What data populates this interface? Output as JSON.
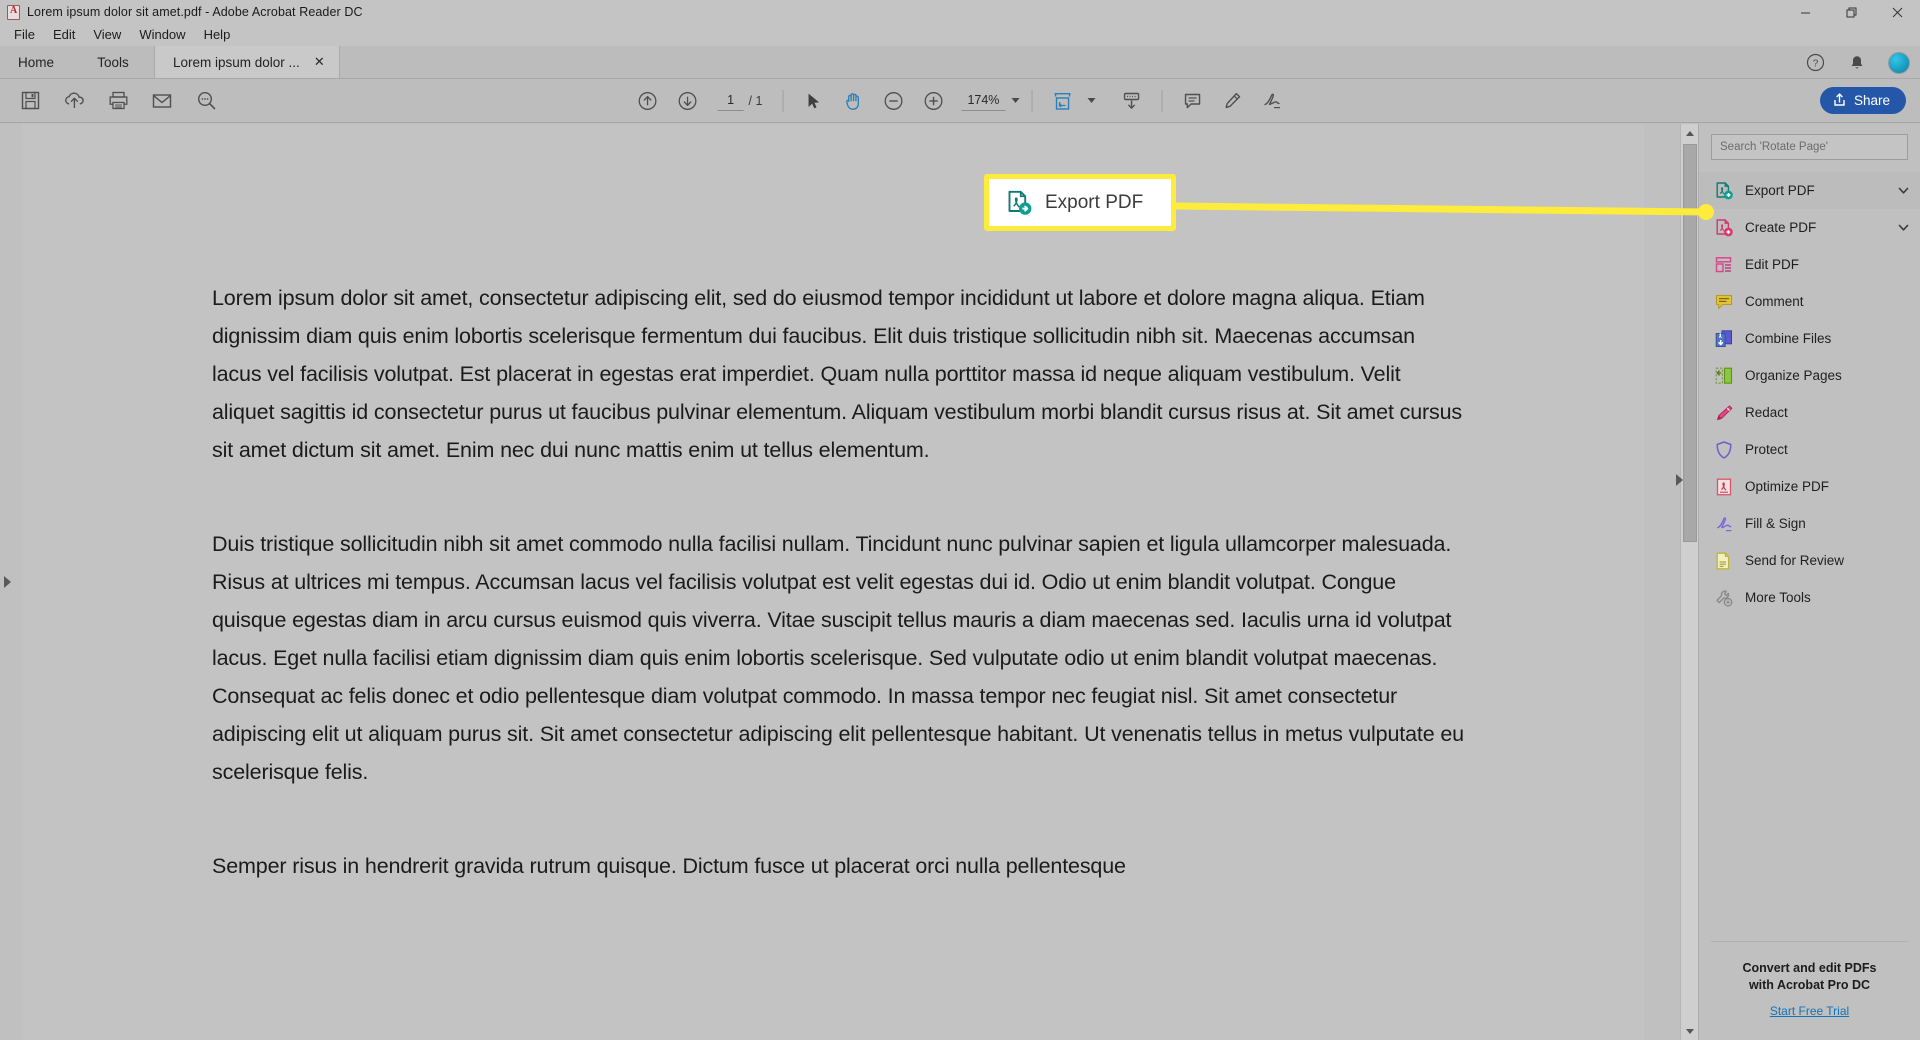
{
  "window": {
    "title": "Lorem ipsum dolor sit amet.pdf - Adobe Acrobat Reader DC",
    "app_icon": "acrobat-icon",
    "controls": {
      "minimize": "minimize",
      "restore": "restore",
      "close": "close"
    }
  },
  "menubar": {
    "items": [
      "File",
      "Edit",
      "View",
      "Window",
      "Help"
    ]
  },
  "tabs": {
    "home": "Home",
    "tools": "Tools",
    "document": "Lorem ipsum dolor ...",
    "close_label": "✕"
  },
  "tabbar_right": {
    "help_icon": "help-circle-icon",
    "bell_icon": "notification-bell-icon",
    "avatar": "user-avatar"
  },
  "toolbar": {
    "left_icons": [
      "save-icon",
      "upload-cloud-icon",
      "print-icon",
      "email-icon",
      "search-icon"
    ],
    "page_current": "1",
    "page_separator": "/ 1",
    "page_total": "1",
    "select_tool": "select-cursor-icon",
    "hand_tool": "hand-tool-icon",
    "zoom_out": "zoom-out-icon",
    "zoom_in": "zoom-in-icon",
    "zoom_value": "174%",
    "fit_page": "fit-page-icon",
    "scroll_mode": "page-scroll-icon",
    "comment_icon": "comment-icon",
    "highlight_icon": "highlighter-icon",
    "sign_icon": "sign-icon",
    "share_label": "Share",
    "share_icon": "share-upload-icon",
    "share_color": "#2557a8"
  },
  "document": {
    "paragraphs": [
      "Lorem ipsum dolor sit amet, consectetur adipiscing elit, sed do eiusmod tempor incididunt ut labore et dolore magna aliqua. Etiam dignissim diam quis enim lobortis scelerisque fermentum dui faucibus. Elit duis tristique sollicitudin nibh sit. Maecenas accumsan lacus vel facilisis volutpat. Est placerat in egestas erat imperdiet. Quam nulla porttitor massa id neque aliquam vestibulum. Velit aliquet sagittis id consectetur purus ut faucibus pulvinar elementum. Aliquam vestibulum morbi blandit cursus risus at. Sit amet cursus sit amet dictum sit amet. Enim nec dui nunc mattis enim ut tellus elementum.",
      "Duis tristique sollicitudin nibh sit amet commodo nulla facilisi nullam. Tincidunt nunc pulvinar sapien et ligula ullamcorper malesuada. Risus at ultrices mi tempus. Accumsan lacus vel facilisis volutpat est velit egestas dui id. Odio ut enim blandit volutpat. Congue quisque egestas diam in arcu cursus euismod quis viverra. Vitae suscipit tellus mauris a diam maecenas sed. Iaculis urna id volutpat lacus. Eget nulla facilisi etiam dignissim diam quis enim lobortis scelerisque. Sed vulputate odio ut enim blandit volutpat maecenas. Consequat ac felis donec et odio pellentesque diam volutpat commodo. In massa tempor nec feugiat nisl. Sit amet consectetur adipiscing elit ut aliquam purus sit. Sit amet consectetur adipiscing elit pellentesque habitant. Ut venenatis tellus in metus vulputate eu scelerisque felis.",
      "Semper risus in hendrerit gravida rutrum quisque. Dictum fusce ut placerat orci nulla pellentesque"
    ]
  },
  "sidebar": {
    "search_placeholder": "Search 'Rotate Page'",
    "items": [
      {
        "label": "Export PDF",
        "icon": "export-pdf-icon",
        "chevron": true
      },
      {
        "label": "Create PDF",
        "icon": "create-pdf-icon",
        "chevron": true
      },
      {
        "label": "Edit PDF",
        "icon": "edit-pdf-icon",
        "chevron": false
      },
      {
        "label": "Comment",
        "icon": "comment-icon",
        "chevron": false
      },
      {
        "label": "Combine Files",
        "icon": "combine-files-icon",
        "chevron": false
      },
      {
        "label": "Organize Pages",
        "icon": "organize-pages-icon",
        "chevron": false
      },
      {
        "label": "Redact",
        "icon": "redact-icon",
        "chevron": false
      },
      {
        "label": "Protect",
        "icon": "protect-shield-icon",
        "chevron": false
      },
      {
        "label": "Optimize PDF",
        "icon": "optimize-pdf-icon",
        "chevron": false
      },
      {
        "label": "Fill & Sign",
        "icon": "fill-sign-icon",
        "chevron": false
      },
      {
        "label": "Send for Review",
        "icon": "send-review-icon",
        "chevron": false
      },
      {
        "label": "More Tools",
        "icon": "more-tools-icon",
        "chevron": false
      }
    ],
    "promo_line1": "Convert and edit PDFs",
    "promo_line2": "with Acrobat Pro DC",
    "promo_link": "Start Free Trial"
  },
  "callout": {
    "label": "Export PDF",
    "icon": "export-pdf-icon",
    "highlight_color": "#fdec3b",
    "box_background": "#ffffff"
  }
}
